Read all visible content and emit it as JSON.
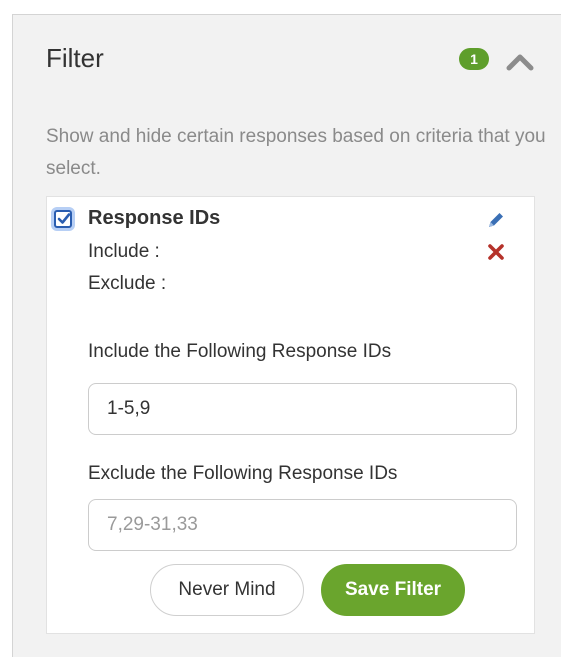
{
  "filter_panel": {
    "title": "Filter",
    "active_count": "1",
    "description": "Show and hide certain responses based on criteria that you select.",
    "collapse_icon": "chevron-up-icon"
  },
  "rule": {
    "checked": true,
    "title": "Response IDs",
    "include_line": "Include :",
    "exclude_line": "Exclude :",
    "edit_icon": "pencil-icon",
    "delete_icon": "close-x-icon"
  },
  "form": {
    "include_label": "Include the Following Response IDs",
    "include_value": "1-5,9",
    "exclude_label": "Exclude the Following Response IDs",
    "exclude_value": "",
    "exclude_placeholder": "7,29-31,33",
    "cancel_label": "Never Mind",
    "save_label": "Save Filter"
  },
  "colors": {
    "accent_green": "#6aa52d",
    "badge_green": "#5e9e2b",
    "checkbox_blue": "#2a5db0",
    "delete_red": "#b5322a",
    "edit_blue": "#3a6fb5"
  }
}
